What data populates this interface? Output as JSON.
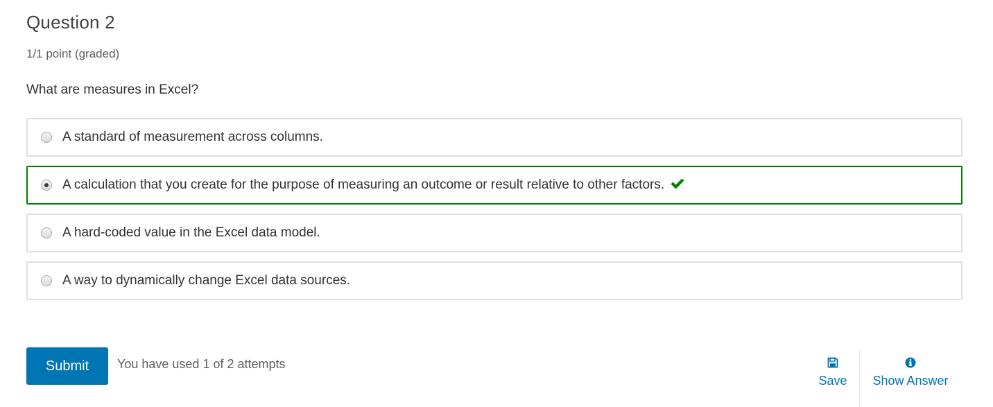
{
  "question": {
    "title": "Question 2",
    "points": "1/1 point (graded)",
    "prompt": "What are measures in Excel?"
  },
  "options": [
    {
      "label": "A standard of measurement across columns.",
      "selected": false,
      "correct": false
    },
    {
      "label": "A calculation that you create for the purpose of measuring an outcome or result relative to other factors.",
      "selected": true,
      "correct": true,
      "status_icon": "checkmark-icon"
    },
    {
      "label": "A hard-coded value in the Excel data model.",
      "selected": false,
      "correct": false
    },
    {
      "label": "A way to dynamically change Excel data sources.",
      "selected": false,
      "correct": false
    }
  ],
  "footer": {
    "submit_label": "Submit",
    "attempts_text": "You have used 1 of 2 attempts",
    "save_label": "Save",
    "save_icon": "floppy-disk-icon",
    "show_answer_label": "Show Answer",
    "show_answer_icon": "info-circle-icon"
  },
  "colors": {
    "accent": "#0075b4",
    "correct": "#008100",
    "border": "#dedede"
  }
}
